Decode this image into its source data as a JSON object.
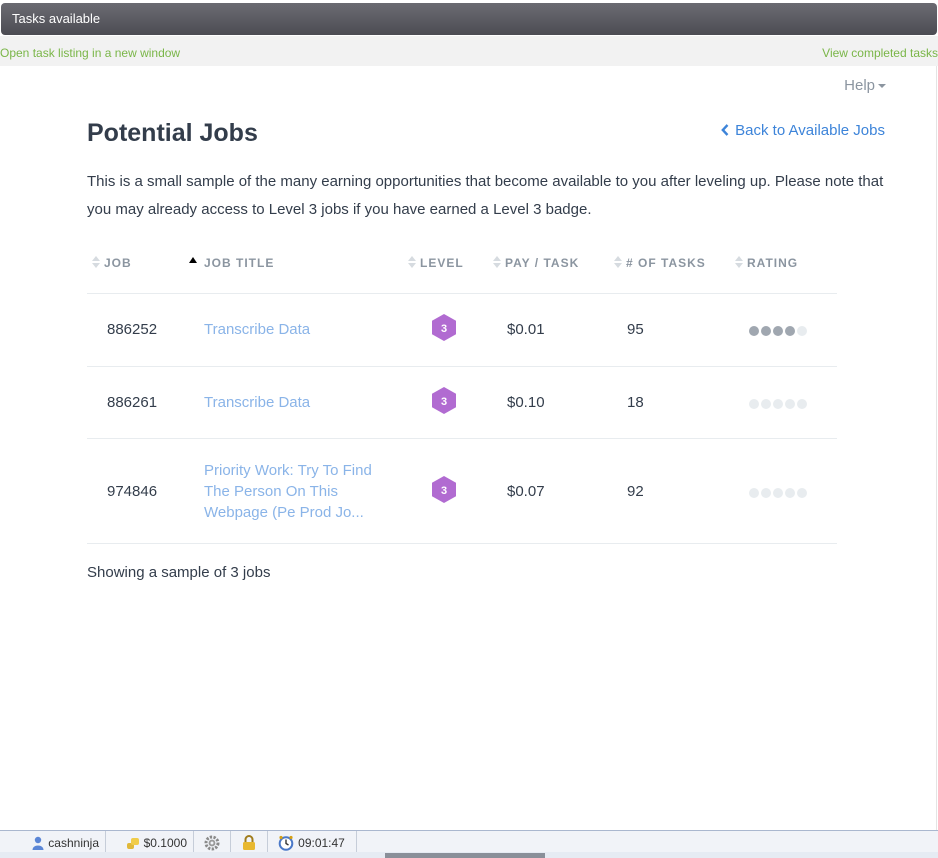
{
  "window": {
    "title": "Tasks available"
  },
  "linkbar": {
    "open_new_window": "Open task listing in a new window",
    "view_completed": "View completed tasks"
  },
  "page": {
    "help": "Help",
    "title": "Potential Jobs",
    "back_link": "Back to Available Jobs",
    "intro": "This is a small sample of the many earning opportunities that become available to you after leveling up. Please note that you may already access to Level 3 jobs if you have earned a Level 3 badge.",
    "footer": "Showing a sample of 3 jobs"
  },
  "table": {
    "headers": {
      "job": "JOB",
      "job_title": "JOB TITLE",
      "level": "LEVEL",
      "pay": "PAY / TASK",
      "tasks": "# OF TASKS",
      "rating": "RATING"
    },
    "rows": [
      {
        "job": "886252",
        "title": "Transcribe Data",
        "level": "3",
        "pay": "$0.01",
        "tasks": "95",
        "rating": 4
      },
      {
        "job": "886261",
        "title": "Transcribe Data",
        "level": "3",
        "pay": "$0.10",
        "tasks": "18",
        "rating": 0
      },
      {
        "job": "974846",
        "title": "Priority Work: Try To Find The Person On This Webpage (Pe Prod Jo...",
        "level": "3",
        "pay": "$0.07",
        "tasks": "92",
        "rating": 0
      }
    ]
  },
  "colors": {
    "badge": "#b16bd1",
    "link": "#3d84d9",
    "green_link": "#7ab648"
  },
  "statusbar": {
    "user": "cashninja",
    "balance": "$0.1000",
    "time": "09:01:47"
  }
}
